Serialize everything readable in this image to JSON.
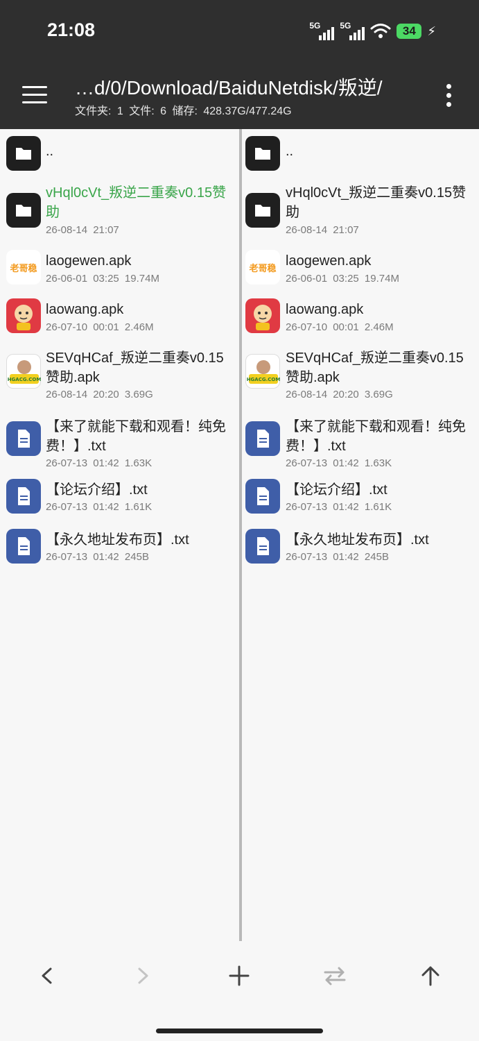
{
  "status": {
    "time": "21:08",
    "net1": "5G",
    "net2": "5G",
    "battery": "34"
  },
  "header": {
    "path": "…d/0/Download/BaiduNetdisk/叛逆/",
    "stats": "文件夹: 1  文件: 6  储存: 428.37G/477.24G"
  },
  "left_pane": {
    "items": [
      {
        "name": "..",
        "meta": ""
      },
      {
        "name": "vHql0cVt_叛逆二重奏v0.15赞助",
        "meta": "26-08-14 21:07"
      },
      {
        "name": "laogewen.apk",
        "meta": "26-06-01 03:25  19.74M"
      },
      {
        "name": "laowang.apk",
        "meta": "26-07-10 00:01  2.46M"
      },
      {
        "name": "SEVqHCaf_叛逆二重奏v0.15赞助.apk",
        "meta": "26-08-14 20:20  3.69G"
      },
      {
        "name": "【来了就能下载和观看！纯免费！】.txt",
        "meta": "26-07-13 01:42  1.63K"
      },
      {
        "name": "【论坛介绍】.txt",
        "meta": "26-07-13 01:42  1.61K"
      },
      {
        "name": "【永久地址发布页】.txt",
        "meta": "26-07-13 01:42  245B"
      }
    ]
  },
  "right_pane": {
    "items": [
      {
        "name": "..",
        "meta": ""
      },
      {
        "name": "vHql0cVt_叛逆二重奏v0.15赞助",
        "meta": "26-08-14 21:07"
      },
      {
        "name": "laogewen.apk",
        "meta": "26-06-01 03:25  19.74M"
      },
      {
        "name": "laowang.apk",
        "meta": "26-07-10 00:01  2.46M"
      },
      {
        "name": "SEVqHCaf_叛逆二重奏v0.15赞助.apk",
        "meta": "26-08-14 20:20  3.69G"
      },
      {
        "name": "【来了就能下载和观看！纯免费！】.txt",
        "meta": "26-07-13 01:42  1.63K"
      },
      {
        "name": "【论坛介绍】.txt",
        "meta": "26-07-13 01:42  1.61K"
      },
      {
        "name": "【永久地址发布页】.txt",
        "meta": "26-07-13 01:42  245B"
      }
    ]
  },
  "apk_icons": {
    "laogewen": "老哥稳",
    "photo": "模网社区 HGACG.COM"
  },
  "colors": {
    "highlight": "#3aa54a",
    "bar": "#2f2f2f",
    "txt_icon": "#3f5ea8"
  }
}
